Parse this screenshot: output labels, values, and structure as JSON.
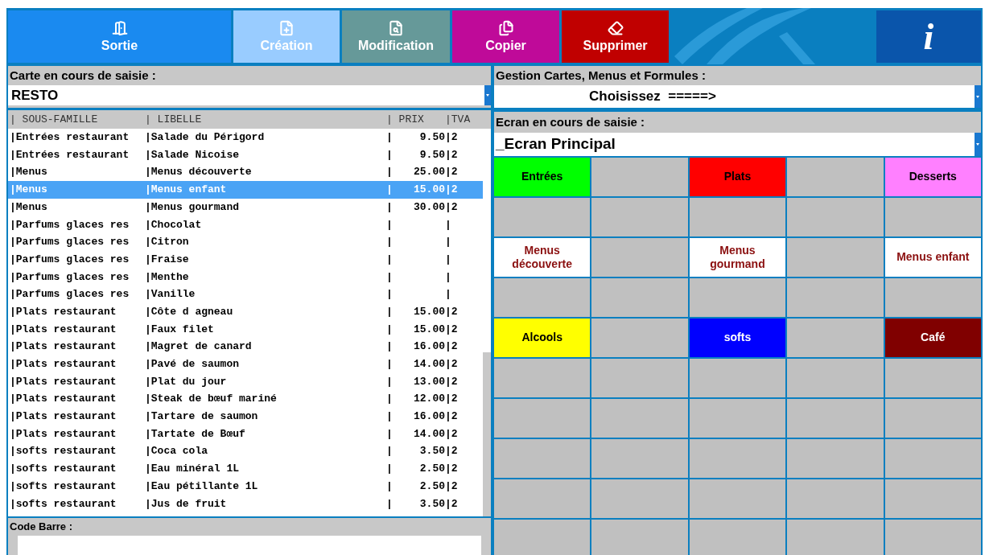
{
  "toolbar": {
    "buttons": [
      {
        "kind": "exit",
        "label": "Sortie",
        "color": "#1a8af0"
      },
      {
        "kind": "create",
        "label": "Création",
        "color": "#99ccff"
      },
      {
        "kind": "edit",
        "label": "Modification",
        "color": "#669999"
      },
      {
        "kind": "copy",
        "label": "Copier",
        "color": "#bf0a99"
      },
      {
        "kind": "delete",
        "label": "Supprimer",
        "color": "#c00000"
      }
    ],
    "info_button": {
      "label": "i"
    }
  },
  "left": {
    "carte_label": "Carte en cours de saisie :",
    "carte_value": "RESTO",
    "table": {
      "columns": [
        "| SOUS-FAMILLE",
        "| LIBELLE",
        "| PRIX",
        "",
        "|TVA"
      ],
      "rows": [
        {
          "cells": [
            "|Entrées restaurant",
            "|Salade du Périgord",
            "|",
            "9.50",
            "|2"
          ],
          "selected": false
        },
        {
          "cells": [
            "|Entrées restaurant",
            "|Salade Nicoise",
            "|",
            "9.50",
            "|2"
          ],
          "selected": false
        },
        {
          "cells": [
            "|Menus",
            "|Menus découverte",
            "|",
            "25.00",
            "|2"
          ],
          "selected": false
        },
        {
          "cells": [
            "|Menus",
            "|Menus enfant",
            "|",
            "15.00",
            "|2"
          ],
          "selected": true
        },
        {
          "cells": [
            "|Menus",
            "|Menus gourmand",
            "|",
            "30.00",
            "|2"
          ],
          "selected": false
        },
        {
          "cells": [
            "|Parfums glaces res",
            "|Chocolat",
            "|",
            "",
            "|"
          ],
          "selected": false
        },
        {
          "cells": [
            "|Parfums glaces res",
            "|Citron",
            "|",
            "",
            "|"
          ],
          "selected": false
        },
        {
          "cells": [
            "|Parfums glaces res",
            "|Fraise",
            "|",
            "",
            "|"
          ],
          "selected": false
        },
        {
          "cells": [
            "|Parfums glaces res",
            "|Menthe",
            "|",
            "",
            "|"
          ],
          "selected": false
        },
        {
          "cells": [
            "|Parfums glaces res",
            "|Vanille",
            "|",
            "",
            "|"
          ],
          "selected": false
        },
        {
          "cells": [
            "|Plats restaurant",
            "|Côte d agneau",
            "|",
            "15.00",
            "|2"
          ],
          "selected": false
        },
        {
          "cells": [
            "|Plats restaurant",
            "|Faux filet",
            "|",
            "15.00",
            "|2"
          ],
          "selected": false
        },
        {
          "cells": [
            "|Plats restaurant",
            "|Magret de canard",
            "|",
            "16.00",
            "|2"
          ],
          "selected": false
        },
        {
          "cells": [
            "|Plats restaurant",
            "|Pavé de saumon",
            "|",
            "14.00",
            "|2"
          ],
          "selected": false
        },
        {
          "cells": [
            "|Plats restaurant",
            "|Plat du jour",
            "|",
            "13.00",
            "|2"
          ],
          "selected": false
        },
        {
          "cells": [
            "|Plats restaurant",
            "|Steak de bœuf mariné",
            "|",
            "12.00",
            "|2"
          ],
          "selected": false
        },
        {
          "cells": [
            "|Plats restaurant",
            "|Tartare de saumon",
            "|",
            "16.00",
            "|2"
          ],
          "selected": false
        },
        {
          "cells": [
            "|Plats restaurant",
            "|Tartate de Bœuf",
            "|",
            "14.00",
            "|2"
          ],
          "selected": false
        },
        {
          "cells": [
            "|softs restaurant",
            "|Coca cola",
            "|",
            "3.50",
            "|2"
          ],
          "selected": false
        },
        {
          "cells": [
            "|softs restaurant",
            "|Eau minéral 1L",
            "|",
            "2.50",
            "|2"
          ],
          "selected": false
        },
        {
          "cells": [
            "|softs restaurant",
            "|Eau pétillante 1L",
            "|",
            "2.50",
            "|2"
          ],
          "selected": false
        },
        {
          "cells": [
            "|softs restaurant",
            "|Jus de fruit",
            "|",
            "3.50",
            "|2"
          ],
          "selected": false
        }
      ]
    },
    "barcode_label": "Code Barre :"
  },
  "right": {
    "gestion_label": "Gestion Cartes, Menus et Formules  :",
    "gestion_value": "Choisissez  =====>",
    "ecran_label": "Ecran en cours de saisie :",
    "ecran_value": "_Ecran Principal",
    "grid": [
      [
        {
          "kind": "dark",
          "label": "Entrées",
          "color": "#00ff00"
        },
        {
          "kind": "empty"
        },
        {
          "kind": "dark",
          "label": "Plats",
          "color": "#ff0000"
        },
        {
          "kind": "empty"
        },
        {
          "kind": "dark",
          "label": "Desserts",
          "color": "#ff80ff"
        }
      ],
      [
        {
          "kind": "empty"
        },
        {
          "kind": "empty"
        },
        {
          "kind": "empty"
        },
        {
          "kind": "empty"
        },
        {
          "kind": "empty"
        }
      ],
      [
        {
          "kind": "accent",
          "label": "Menus découverte",
          "color": "#ffffff"
        },
        {
          "kind": "empty"
        },
        {
          "kind": "accent",
          "label": "Menus gourmand",
          "color": "#ffffff"
        },
        {
          "kind": "empty"
        },
        {
          "kind": "accent",
          "label": "Menus enfant",
          "color": "#ffffff"
        }
      ],
      [
        {
          "kind": "empty"
        },
        {
          "kind": "empty"
        },
        {
          "kind": "empty"
        },
        {
          "kind": "empty"
        },
        {
          "kind": "empty"
        }
      ],
      [
        {
          "kind": "dark",
          "label": "Alcools",
          "color": "#ffff00"
        },
        {
          "kind": "empty"
        },
        {
          "kind": "light",
          "label": "softs",
          "color": "#0000ff"
        },
        {
          "kind": "empty"
        },
        {
          "kind": "light",
          "label": "Café",
          "color": "#800000"
        }
      ],
      [
        {
          "kind": "empty"
        },
        {
          "kind": "empty"
        },
        {
          "kind": "empty"
        },
        {
          "kind": "empty"
        },
        {
          "kind": "empty"
        }
      ],
      [
        {
          "kind": "empty"
        },
        {
          "kind": "empty"
        },
        {
          "kind": "empty"
        },
        {
          "kind": "empty"
        },
        {
          "kind": "empty"
        }
      ],
      [
        {
          "kind": "empty"
        },
        {
          "kind": "empty"
        },
        {
          "kind": "empty"
        },
        {
          "kind": "empty"
        },
        {
          "kind": "empty"
        }
      ],
      [
        {
          "kind": "empty"
        },
        {
          "kind": "empty"
        },
        {
          "kind": "empty"
        },
        {
          "kind": "empty"
        },
        {
          "kind": "empty"
        }
      ],
      [
        {
          "kind": "empty"
        },
        {
          "kind": "empty"
        },
        {
          "kind": "empty"
        },
        {
          "kind": "empty"
        },
        {
          "kind": "empty"
        }
      ]
    ]
  }
}
